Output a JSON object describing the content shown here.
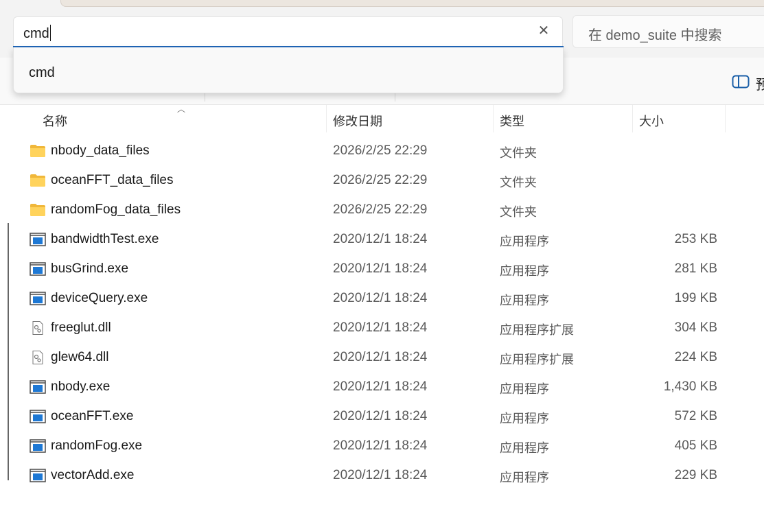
{
  "address_bar": {
    "value": "cmd"
  },
  "search": {
    "placeholder": "在 demo_suite 中搜索"
  },
  "suggestions": [
    {
      "label": "cmd"
    }
  ],
  "toolbar": {
    "preview_label": "预"
  },
  "columns": {
    "name": "名称",
    "date": "修改日期",
    "type": "类型",
    "size": "大小"
  },
  "files": [
    {
      "name": "nbody_data_files",
      "date": "2026/2/25 22:29",
      "type": "文件夹",
      "size": "",
      "icon": "folder-icon"
    },
    {
      "name": "oceanFFT_data_files",
      "date": "2026/2/25 22:29",
      "type": "文件夹",
      "size": "",
      "icon": "folder-icon"
    },
    {
      "name": "randomFog_data_files",
      "date": "2026/2/25 22:29",
      "type": "文件夹",
      "size": "",
      "icon": "folder-icon"
    },
    {
      "name": "bandwidthTest.exe",
      "date": "2020/12/1 18:24",
      "type": "应用程序",
      "size": "253 KB",
      "icon": "application-icon"
    },
    {
      "name": "busGrind.exe",
      "date": "2020/12/1 18:24",
      "type": "应用程序",
      "size": "281 KB",
      "icon": "application-icon"
    },
    {
      "name": "deviceQuery.exe",
      "date": "2020/12/1 18:24",
      "type": "应用程序",
      "size": "199 KB",
      "icon": "application-icon"
    },
    {
      "name": "freeglut.dll",
      "date": "2020/12/1 18:24",
      "type": "应用程序扩展",
      "size": "304 KB",
      "icon": "dll-icon"
    },
    {
      "name": "glew64.dll",
      "date": "2020/12/1 18:24",
      "type": "应用程序扩展",
      "size": "224 KB",
      "icon": "dll-icon"
    },
    {
      "name": "nbody.exe",
      "date": "2020/12/1 18:24",
      "type": "应用程序",
      "size": "1,430 KB",
      "icon": "application-icon"
    },
    {
      "name": "oceanFFT.exe",
      "date": "2020/12/1 18:24",
      "type": "应用程序",
      "size": "572 KB",
      "icon": "application-icon"
    },
    {
      "name": "randomFog.exe",
      "date": "2020/12/1 18:24",
      "type": "应用程序",
      "size": "405 KB",
      "icon": "application-icon"
    },
    {
      "name": "vectorAdd.exe",
      "date": "2020/12/1 18:24",
      "type": "应用程序",
      "size": "229 KB",
      "icon": "application-icon"
    }
  ],
  "colors": {
    "accent": "#1f66b8",
    "folder": "#f5c24d",
    "exe_blue": "#1e78d4"
  }
}
